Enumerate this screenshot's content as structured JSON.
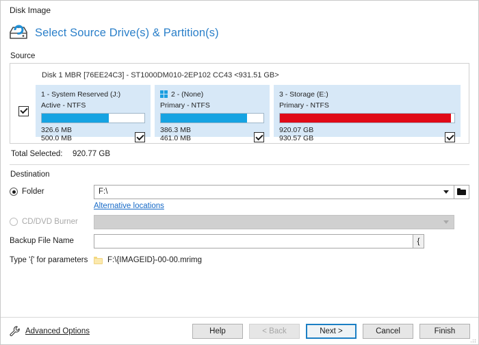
{
  "window": {
    "title": "Disk Image"
  },
  "header": {
    "title": "Select Source Drive(s) & Partition(s)",
    "icon": "disk-refresh-icon"
  },
  "source": {
    "label": "Source",
    "disk_line": "Disk 1 MBR [76EE24C3] - ST1000DM010-2EP102 CC43  <931.51 GB>",
    "disk_checked": true,
    "partitions": [
      {
        "title": "1 - System Reserved (J:)",
        "subtitle": "Active - NTFS",
        "used": "326.6 MB",
        "total": "500.0 MB",
        "fill_percent": 65,
        "fill_color": "#16a3e2",
        "checked": true,
        "has_windows_logo": false
      },
      {
        "title": "2 -  (None)",
        "subtitle": "Primary - NTFS",
        "used": "386.3 MB",
        "total": "461.0 MB",
        "fill_percent": 84,
        "fill_color": "#16a3e2",
        "checked": true,
        "has_windows_logo": true
      },
      {
        "title": "3 - Storage (E:)",
        "subtitle": "Primary - NTFS",
        "used": "920.07 GB",
        "total": "930.57 GB",
        "fill_percent": 98,
        "fill_color": "#e00a17",
        "checked": true,
        "has_windows_logo": false
      }
    ]
  },
  "total": {
    "label": "Total Selected:",
    "value": "920.77 GB"
  },
  "destination": {
    "label": "Destination",
    "folder": {
      "radio_label": "Folder",
      "selected": true,
      "value": "F:\\",
      "placeholder": "",
      "browse_icon": "folder-icon",
      "dropdown_icon": "chevron-down-icon"
    },
    "alternative_locations": "Alternative locations",
    "cddvd": {
      "radio_label": "CD/DVD Burner",
      "selected": false,
      "enabled": false,
      "value": "",
      "dropdown_icon": "chevron-down-icon"
    },
    "backup_file_name": {
      "label": "Backup File Name",
      "value": "",
      "placeholder": "",
      "param_button_label": "{"
    },
    "parameters_hint": {
      "label": "Type '{' for parameters",
      "preview": "F:\\{IMAGEID}-00-00.mrimg",
      "icon": "yellow-folder-icon"
    }
  },
  "footer": {
    "advanced_options": "Advanced Options",
    "advanced_icon": "wrench-icon",
    "buttons": [
      {
        "label": "Help",
        "state": "normal"
      },
      {
        "label": "< Back",
        "state": "disabled"
      },
      {
        "label": "Next >",
        "state": "focused"
      },
      {
        "label": "Cancel",
        "state": "normal"
      },
      {
        "label": "Finish",
        "state": "normal"
      }
    ]
  },
  "colors": {
    "accent_blue": "#2a7fc9",
    "bar_blue": "#16a3e2",
    "bar_red": "#e00a17",
    "partition_bg": "#d7e8f7",
    "link_blue": "#1569c7"
  }
}
